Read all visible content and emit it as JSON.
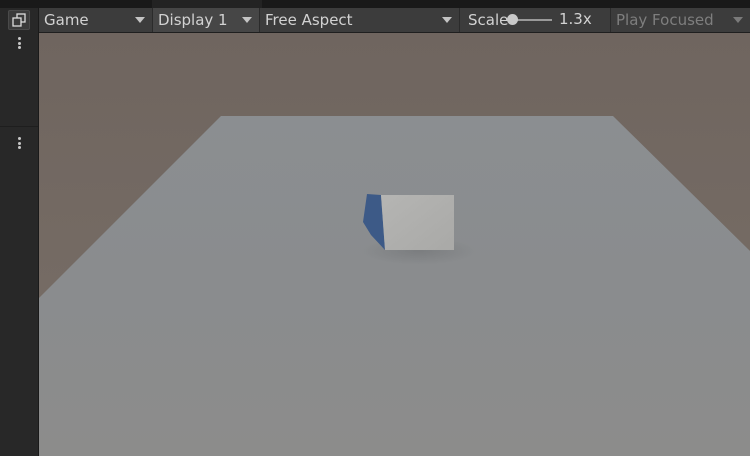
{
  "toolbar": {
    "view_label": "Game",
    "display_label": "Display 1",
    "aspect_label": "Free Aspect",
    "scale_label": "Scale",
    "scale_value": "1.3x",
    "play_mode_label": "Play Focused"
  },
  "icons": {
    "maximize": "maximize-window-icon",
    "more": "vertical-ellipsis-icon",
    "dropdown": "triangle-down-icon"
  },
  "colors": {
    "editor_background": "#282828",
    "toolbar_background": "#3c3c3c",
    "sky": "#766c65",
    "ground_plane": "#8e9092",
    "cube_face": "#b3b3b1",
    "cube_side": "#3c5a8a"
  },
  "scale_slider_fraction": 0.0
}
